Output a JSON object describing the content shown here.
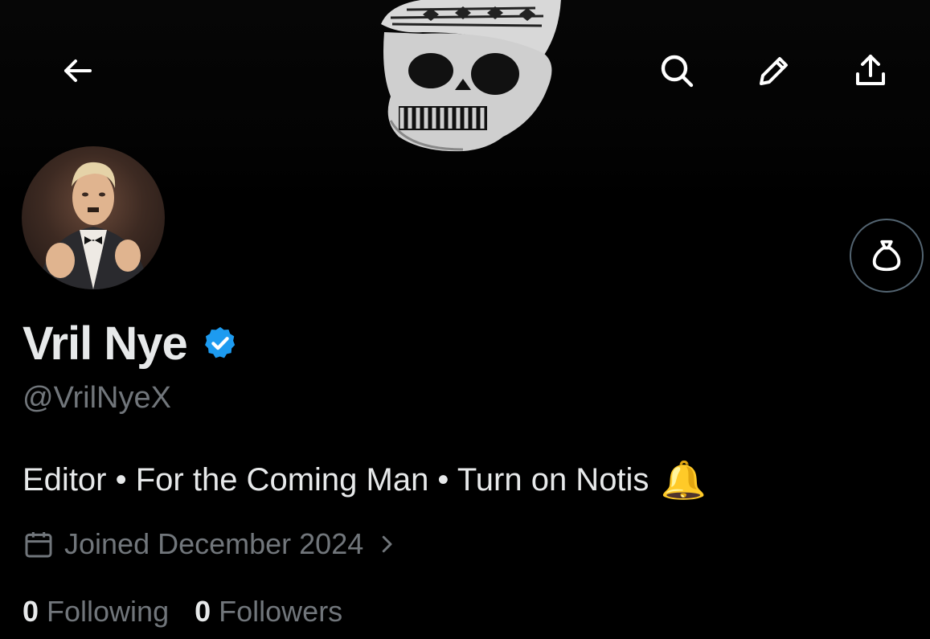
{
  "header": {
    "icons": {
      "back": "back-arrow-icon",
      "search": "search-icon",
      "edit": "pencil-icon",
      "share": "share-icon"
    },
    "banner": "skull banner image"
  },
  "profile": {
    "display_name": "Vril Nye",
    "handle": "@VrilNyeX",
    "verified_color": "#1d9bf0",
    "bio_line": "Editor • For the Coming Man • Turn on Notis",
    "bio_emoji": "🔔",
    "joined_text": "Joined December 2024",
    "following_count": "0",
    "following_label": "Following",
    "followers_count": "0",
    "followers_label": "Followers"
  },
  "colors": {
    "background": "#000000",
    "primary_text": "#e7e9ea",
    "secondary_text": "#71767b",
    "border": "#536471"
  }
}
